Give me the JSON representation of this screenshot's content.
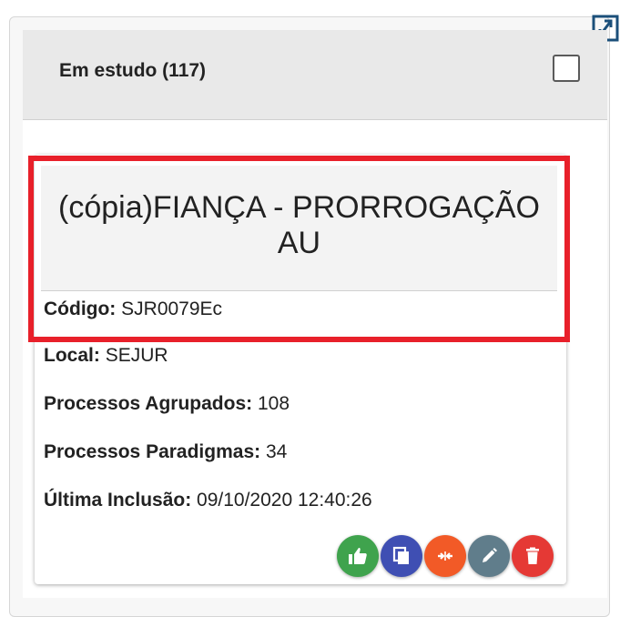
{
  "column": {
    "title": "Em estudo (117)"
  },
  "card": {
    "title": "(cópia)FIANÇA - PRORROGAÇÃO AU",
    "fields": [
      {
        "label": "Código:",
        "value": "SJR0079Ec"
      },
      {
        "label": "Local:",
        "value": "SEJUR"
      },
      {
        "label": "Processos Agrupados:",
        "value": "108"
      },
      {
        "label": "Processos Paradigmas:",
        "value": "34"
      },
      {
        "label": "Última Inclusão:",
        "value": "09/10/2020 12:40:26"
      }
    ],
    "actions": [
      {
        "icon": "thumbs-up-icon",
        "color": "#3fa34d"
      },
      {
        "icon": "copy-icon",
        "color": "#3f4fb3"
      },
      {
        "icon": "merge-icon",
        "color": "#f25a27"
      },
      {
        "icon": "edit-icon",
        "color": "#607d8b"
      },
      {
        "icon": "delete-icon",
        "color": "#e53935"
      }
    ]
  },
  "colors": {
    "highlight": "#e8202a",
    "header_bg": "#e9e9e9"
  }
}
